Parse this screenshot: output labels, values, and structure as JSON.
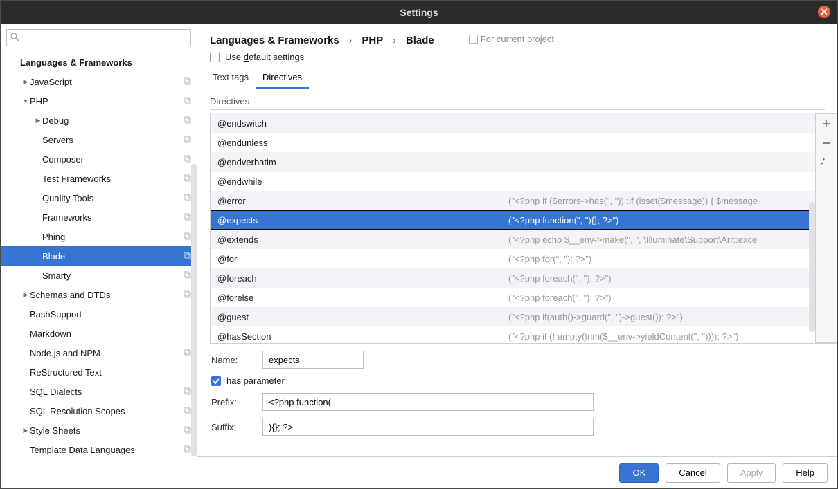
{
  "title": "Settings",
  "breadcrumb": [
    "Languages & Frameworks",
    "PHP",
    "Blade"
  ],
  "project_note": "For current project",
  "use_default_label_pre": "Use ",
  "use_default_label_u": "d",
  "use_default_label_post": "efault settings",
  "tabs": {
    "text_tags": "Text tags",
    "directives": "Directives"
  },
  "section_title": "Directives",
  "sidebar": {
    "root": "Languages & Frameworks",
    "items": [
      {
        "label": "JavaScript",
        "depth": 0,
        "arrow": "right",
        "copy": true
      },
      {
        "label": "PHP",
        "depth": 0,
        "arrow": "down",
        "copy": true
      },
      {
        "label": "Debug",
        "depth": 1,
        "arrow": "right",
        "copy": true
      },
      {
        "label": "Servers",
        "depth": 1,
        "arrow": "",
        "copy": true
      },
      {
        "label": "Composer",
        "depth": 1,
        "arrow": "",
        "copy": true
      },
      {
        "label": "Test Frameworks",
        "depth": 1,
        "arrow": "",
        "copy": true
      },
      {
        "label": "Quality Tools",
        "depth": 1,
        "arrow": "",
        "copy": true
      },
      {
        "label": "Frameworks",
        "depth": 1,
        "arrow": "",
        "copy": true
      },
      {
        "label": "Phing",
        "depth": 1,
        "arrow": "",
        "copy": true
      },
      {
        "label": "Blade",
        "depth": 1,
        "arrow": "",
        "copy": true,
        "selected": true
      },
      {
        "label": "Smarty",
        "depth": 1,
        "arrow": "",
        "copy": true
      },
      {
        "label": "Schemas and DTDs",
        "depth": 0,
        "arrow": "right",
        "copy": true
      },
      {
        "label": "BashSupport",
        "depth": 0,
        "arrow": "",
        "copy": false
      },
      {
        "label": "Markdown",
        "depth": 0,
        "arrow": "",
        "copy": false
      },
      {
        "label": "Node.js and NPM",
        "depth": 0,
        "arrow": "",
        "copy": true
      },
      {
        "label": "ReStructured Text",
        "depth": 0,
        "arrow": "",
        "copy": false
      },
      {
        "label": "SQL Dialects",
        "depth": 0,
        "arrow": "",
        "copy": true
      },
      {
        "label": "SQL Resolution Scopes",
        "depth": 0,
        "arrow": "",
        "copy": true
      },
      {
        "label": "Style Sheets",
        "depth": 0,
        "arrow": "right",
        "copy": true
      },
      {
        "label": "Template Data Languages",
        "depth": 0,
        "arrow": "",
        "copy": true
      }
    ]
  },
  "directives": [
    {
      "name": "@endswitch",
      "rhs": ""
    },
    {
      "name": "@endunless",
      "rhs": ""
    },
    {
      "name": "@endverbatim",
      "rhs": ""
    },
    {
      "name": "@endwhile",
      "rhs": ""
    },
    {
      "name": "@error",
      "rhs": "(\"<?php if ($errors->has(\", \")) :if (isset($message)) { $message"
    },
    {
      "name": "@expects",
      "rhs": "(\"<?php function(\", \"){}; ?>\")",
      "selected": true
    },
    {
      "name": "@extends",
      "rhs": "(\"<?php echo $__env->make(\", \", \\Illuminate\\Support\\Arr::exce"
    },
    {
      "name": "@for",
      "rhs": "(\"<?php for(\", \"): ?>\")"
    },
    {
      "name": "@foreach",
      "rhs": "(\"<?php foreach(\", \"): ?>\")"
    },
    {
      "name": "@forelse",
      "rhs": "(\"<?php foreach(\", \"): ?>\")"
    },
    {
      "name": "@guest",
      "rhs": "(\"<?php if(auth()->guard(\", \")->guest()): ?>\")"
    },
    {
      "name": "@hasSection",
      "rhs": "(\"<?php if (! empty(trim($__env->yieldContent(\", \")))): ?>\")"
    }
  ],
  "form": {
    "name_label": "Name:",
    "name_value": "expects",
    "has_param_pre": "",
    "has_param_u": "h",
    "has_param_post": "as parameter",
    "prefix_label": "Prefix:",
    "prefix_value": "<?php function(",
    "suffix_label": "Suffix:",
    "suffix_value": "){}; ?>"
  },
  "buttons": {
    "ok": "OK",
    "cancel": "Cancel",
    "apply": "Apply",
    "help": "Help"
  }
}
